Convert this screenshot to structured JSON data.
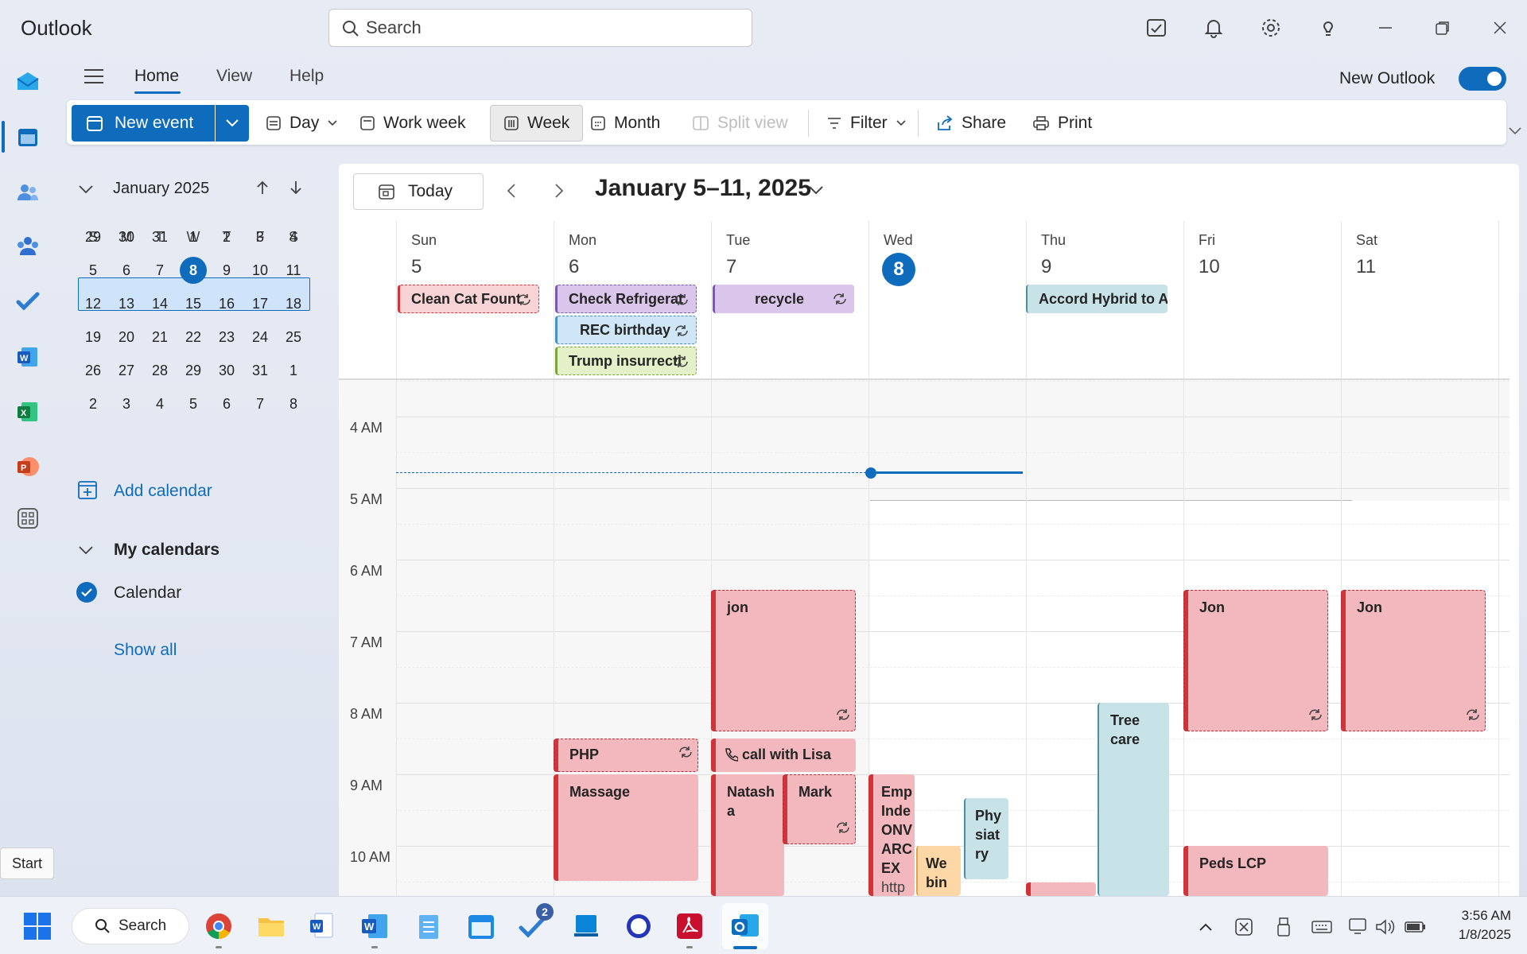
{
  "app": {
    "title": "Outlook"
  },
  "search": {
    "placeholder": "Search"
  },
  "ribbon": {
    "tabs": [
      "Home",
      "View",
      "Help"
    ],
    "new_outlook_label": "New Outlook",
    "new_outlook_on": true,
    "new_event_label": "New event",
    "tools": {
      "day": "Day",
      "work_week": "Work week",
      "week": "Week",
      "month": "Month",
      "split_view": "Split view",
      "filter": "Filter",
      "share": "Share",
      "print": "Print"
    }
  },
  "mini_calendar": {
    "month_label": "January 2025",
    "weekday_headers": [
      "S",
      "M",
      "T",
      "W",
      "T",
      "F",
      "S"
    ],
    "weeks": [
      [
        "29",
        "30",
        "31",
        "1",
        "2",
        "3",
        "4"
      ],
      [
        "5",
        "6",
        "7",
        "8",
        "9",
        "10",
        "11"
      ],
      [
        "12",
        "13",
        "14",
        "15",
        "16",
        "17",
        "18"
      ],
      [
        "19",
        "20",
        "21",
        "22",
        "23",
        "24",
        "25"
      ],
      [
        "26",
        "27",
        "28",
        "29",
        "30",
        "31",
        "1"
      ],
      [
        "2",
        "3",
        "4",
        "5",
        "6",
        "7",
        "8"
      ]
    ],
    "selected_week_index": 1,
    "today": "8"
  },
  "left_pane": {
    "add_calendar": "Add calendar",
    "my_calendars": "My calendars",
    "calendars": [
      "Calendar"
    ],
    "show_all": "Show all"
  },
  "calendar": {
    "today_button": "Today",
    "range_title": "January 5–11, 2025",
    "days": [
      {
        "name": "Sun",
        "num": "5"
      },
      {
        "name": "Mon",
        "num": "6"
      },
      {
        "name": "Tue",
        "num": "7"
      },
      {
        "name": "Wed",
        "num": "8",
        "today": true
      },
      {
        "name": "Thu",
        "num": "9"
      },
      {
        "name": "Fri",
        "num": "10"
      },
      {
        "name": "Sat",
        "num": "11"
      }
    ],
    "times": [
      "4 AM",
      "5 AM",
      "6 AM",
      "7 AM",
      "8 AM",
      "9 AM",
      "10 AM"
    ],
    "all_day_events": [
      {
        "title": "Clean Cat Fount",
        "day": "Sun",
        "recurring": true
      },
      {
        "title": "Check Refrigerat",
        "day": "Mon",
        "recurring": true
      },
      {
        "title": "REC birthday",
        "day": "Mon",
        "recurring": true
      },
      {
        "title": "Trump insurrecti",
        "day": "Mon",
        "recurring": true
      },
      {
        "title": "recycle",
        "day": "Tue",
        "recurring": true
      },
      {
        "title": "Accord Hybrid to A",
        "day": "Thu",
        "recurring": false
      }
    ],
    "events": {
      "jon_tue": "jon",
      "jon_fri": "Jon",
      "jon_sat": "Jon",
      "php": "PHP",
      "call_lisa": "call with Lisa",
      "massage": "Massage",
      "natasha": "Natash a",
      "mark": "Mark",
      "emp": "Emp Inde ONV ARC EX",
      "emp_sub": "http",
      "webin": "We bin",
      "physiatry": "Phy siat ry",
      "tree_care": "Tree care",
      "peds_lcp": "Peds LCP"
    }
  },
  "tooltip": {
    "start": "Start"
  },
  "taskbar": {
    "search_label": "Search",
    "todo_badge": "2",
    "time": "3:56 AM",
    "date": "1/8/2025"
  },
  "colors": {
    "accent": "#0f6cbd",
    "event_red": "#f2b8be",
    "event_teal": "#c7e3e8",
    "event_orange": "#fdd8a6",
    "event_purple": "#d9c6ea",
    "event_green": "#e4f0c8",
    "event_blue": "#cfe6f6"
  }
}
